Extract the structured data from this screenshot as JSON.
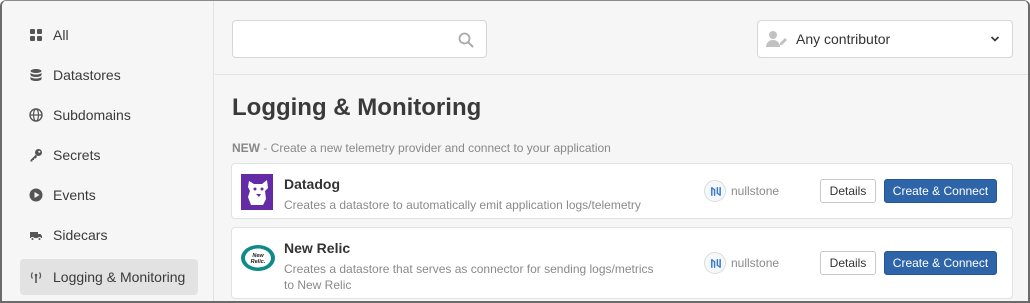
{
  "sidebar": {
    "items": [
      {
        "label": "All",
        "icon": "grid-icon",
        "active": false
      },
      {
        "label": "Datastores",
        "icon": "database-icon",
        "active": false
      },
      {
        "label": "Subdomains",
        "icon": "globe-icon",
        "active": false
      },
      {
        "label": "Secrets",
        "icon": "key-icon",
        "active": false
      },
      {
        "label": "Events",
        "icon": "play-circle-icon",
        "active": false
      },
      {
        "label": "Sidecars",
        "icon": "truck-icon",
        "active": false
      },
      {
        "label": "Logging & Monitoring",
        "icon": "antenna-icon",
        "active": true
      }
    ]
  },
  "search": {
    "value": "",
    "placeholder": ""
  },
  "contributor_filter": {
    "label": "Any contributor"
  },
  "page": {
    "title": "Logging & Monitoring",
    "new_tag": "NEW",
    "new_text": " - Create a new telemetry provider and connect to your application"
  },
  "providers": [
    {
      "name": "Datadog",
      "description": "Creates a datastore to automatically emit application logs/telemetry",
      "publisher": "nullstone",
      "details_label": "Details",
      "create_label": "Create & Connect"
    },
    {
      "name": "New Relic",
      "description": "Creates a datastore that serves as connector for sending logs/metrics to New Relic",
      "publisher": "nullstone",
      "details_label": "Details",
      "create_label": "Create & Connect",
      "logo_text": "New Relic."
    }
  ],
  "colors": {
    "primary_button": "#2e64a8",
    "datadog_purple": "#632ca6",
    "newrelic_teal": "#0f8a8a"
  }
}
